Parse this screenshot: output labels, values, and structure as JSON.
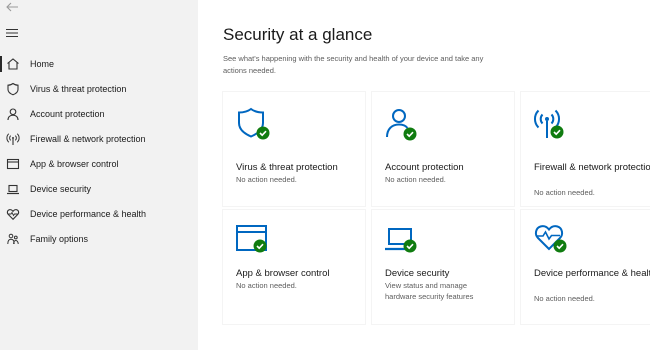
{
  "colors": {
    "accent": "#0067c0",
    "ok": "#107c10",
    "sidebar_bg": "#f2f2f2"
  },
  "sidebar": {
    "items": [
      {
        "label": "Home",
        "icon": "home-icon",
        "active": true
      },
      {
        "label": "Virus & threat protection",
        "icon": "shield-icon"
      },
      {
        "label": "Account protection",
        "icon": "person-icon"
      },
      {
        "label": "Firewall & network protection",
        "icon": "wireless-icon"
      },
      {
        "label": "App & browser control",
        "icon": "browser-window-icon"
      },
      {
        "label": "Device security",
        "icon": "laptop-icon"
      },
      {
        "label": "Device performance & health",
        "icon": "heart-icon"
      },
      {
        "label": "Family options",
        "icon": "family-icon"
      }
    ]
  },
  "main": {
    "title": "Security at a glance",
    "description": "See what's happening with the security and health of your device and take any actions needed.",
    "tiles": [
      {
        "title": "Virus & threat protection",
        "status": "No action needed.",
        "icon": "shield-check-icon"
      },
      {
        "title": "Account protection",
        "status": "No action needed.",
        "icon": "person-check-icon"
      },
      {
        "title": "Firewall & network protection",
        "status": "No action needed.",
        "icon": "wireless-check-icon"
      },
      {
        "title": "App & browser control",
        "status": "No action needed.",
        "icon": "browser-check-icon"
      },
      {
        "title": "Device security",
        "status": "View status and manage hardware security features",
        "icon": "laptop-check-icon"
      },
      {
        "title": "Device performance & health",
        "status": "No action needed.",
        "icon": "heart-check-icon"
      }
    ]
  }
}
